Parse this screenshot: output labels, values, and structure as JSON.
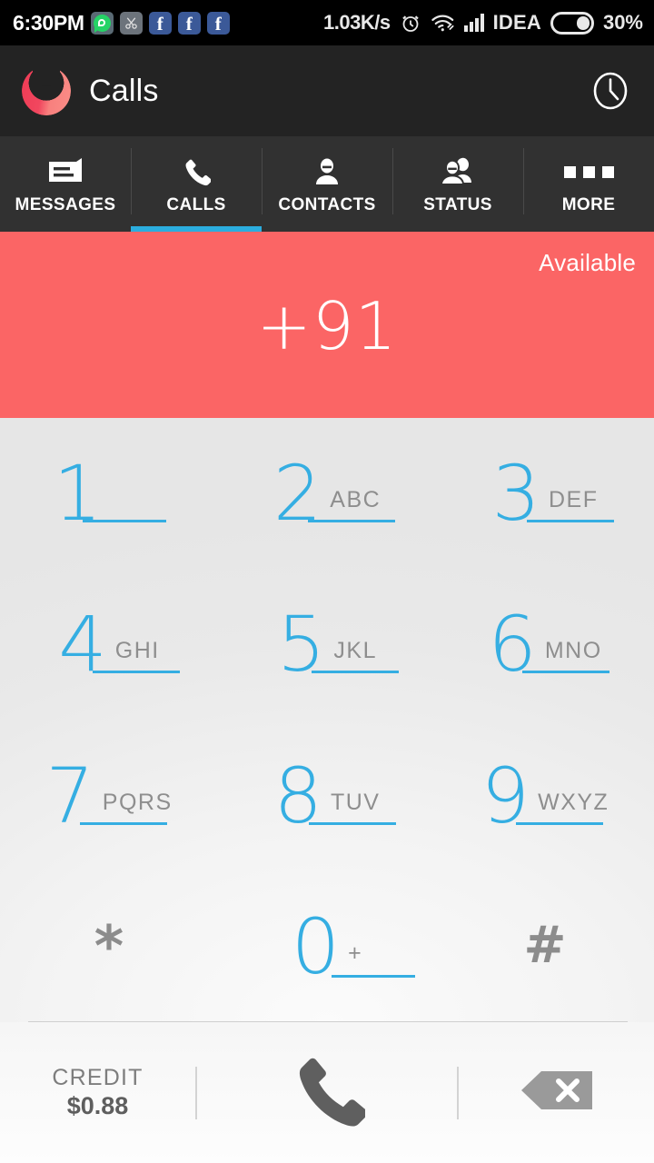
{
  "statusbar": {
    "time": "6:30PM",
    "tray_icons": [
      {
        "name": "whatsapp-icon",
        "label": "WhatsApp"
      },
      {
        "name": "screenshot-icon",
        "label": "Screenshot"
      },
      {
        "name": "facebook-icon",
        "label": "Facebook"
      },
      {
        "name": "facebook-icon",
        "label": "Facebook"
      },
      {
        "name": "facebook-icon",
        "label": "Facebook"
      }
    ],
    "network_speed": "1.03K/s",
    "alarm_icon": "alarm-clock-icon",
    "wifi_icon": "wifi-icon",
    "signal_icon": "signal-bars-icon",
    "carrier": "IDEA",
    "battery_icon": "battery-icon",
    "battery_percent": "30%"
  },
  "appbar": {
    "logo_icon": "app-logo-icon",
    "title": "Calls",
    "history_icon": "clock-history-icon"
  },
  "tabs": {
    "active_index": 1,
    "items": [
      {
        "label": "MESSAGES",
        "icon": "message-icon"
      },
      {
        "label": "CALLS",
        "icon": "phone-icon"
      },
      {
        "label": "CONTACTS",
        "icon": "person-icon"
      },
      {
        "label": "STATUS",
        "icon": "people-icon"
      },
      {
        "label": "MORE",
        "icon": "more-dots-icon"
      }
    ]
  },
  "banner": {
    "availability": "Available",
    "dialed_number": "+91",
    "background_color": "#fb6565"
  },
  "dialpad": {
    "accent_color": "#35aee2",
    "keys": [
      {
        "digit": "1",
        "letters": "",
        "underline": true
      },
      {
        "digit": "2",
        "letters": "ABC",
        "underline": true
      },
      {
        "digit": "3",
        "letters": "DEF",
        "underline": true
      },
      {
        "digit": "4",
        "letters": "GHI",
        "underline": true
      },
      {
        "digit": "5",
        "letters": "JKL",
        "underline": true
      },
      {
        "digit": "6",
        "letters": "MNO",
        "underline": true
      },
      {
        "digit": "7",
        "letters": "PQRS",
        "underline": true
      },
      {
        "digit": "8",
        "letters": "TUV",
        "underline": true
      },
      {
        "digit": "9",
        "letters": "WXYZ",
        "underline": true
      },
      {
        "digit": "*",
        "letters": "",
        "underline": false
      },
      {
        "digit": "0",
        "letters": "+",
        "underline": true
      },
      {
        "digit": "#",
        "letters": "",
        "underline": false
      }
    ]
  },
  "bottombar": {
    "credit_label": "CREDIT",
    "credit_amount": "$0.88",
    "call_icon": "phone-call-icon",
    "delete_icon": "backspace-delete-icon"
  }
}
